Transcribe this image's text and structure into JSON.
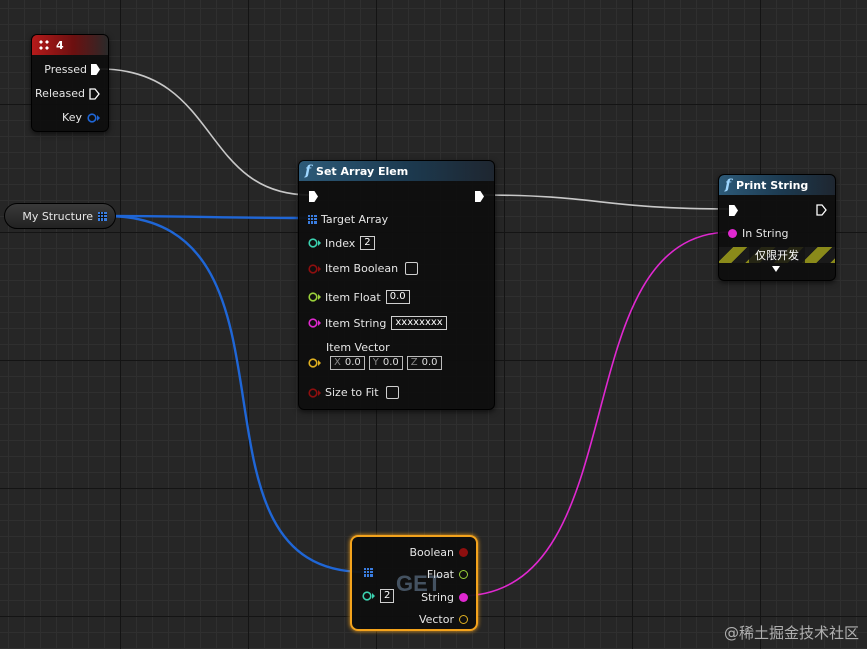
{
  "key_node": {
    "title": "4",
    "pins": [
      "Pressed",
      "Released",
      "Key"
    ]
  },
  "var_node": {
    "label": "My Structure"
  },
  "set_node": {
    "title": "Set Array Elem",
    "target_label": "Target Array",
    "index_label": "Index",
    "index_value": "2",
    "bool_label": "Item Boolean",
    "float_label": "Item Float",
    "float_value": "0.0",
    "string_label": "Item String",
    "string_value": "xxxxxxxx",
    "vector_label": "Item Vector",
    "vector": {
      "x_axis": "X",
      "x": "0.0",
      "y_axis": "Y",
      "y": "0.0",
      "z_axis": "Z",
      "z": "0.0"
    },
    "size_label": "Size to Fit"
  },
  "print_node": {
    "title": "Print String",
    "in_label": "In String",
    "dev_only": "仅限开发"
  },
  "get_node": {
    "watermark": "GET",
    "index_value": "2",
    "outputs": [
      "Boolean",
      "Float",
      "String",
      "Vector"
    ]
  },
  "colors": {
    "exec_wire": "#c8c8c8",
    "struct_wire": "#1f66d6",
    "string_wire": "#e028d0",
    "bool_pin": "#8e0f0f",
    "float_pin": "#9ad13a",
    "int_pin": "#3bd2b0",
    "string_pin": "#e028d0",
    "vector_pin": "#e0b020",
    "accent_select": "#f4a31c"
  },
  "icons": {
    "header_icon_key": "keyboard-icon",
    "header_icon_func": "function-icon"
  },
  "watermark": "@稀土掘金技术社区"
}
